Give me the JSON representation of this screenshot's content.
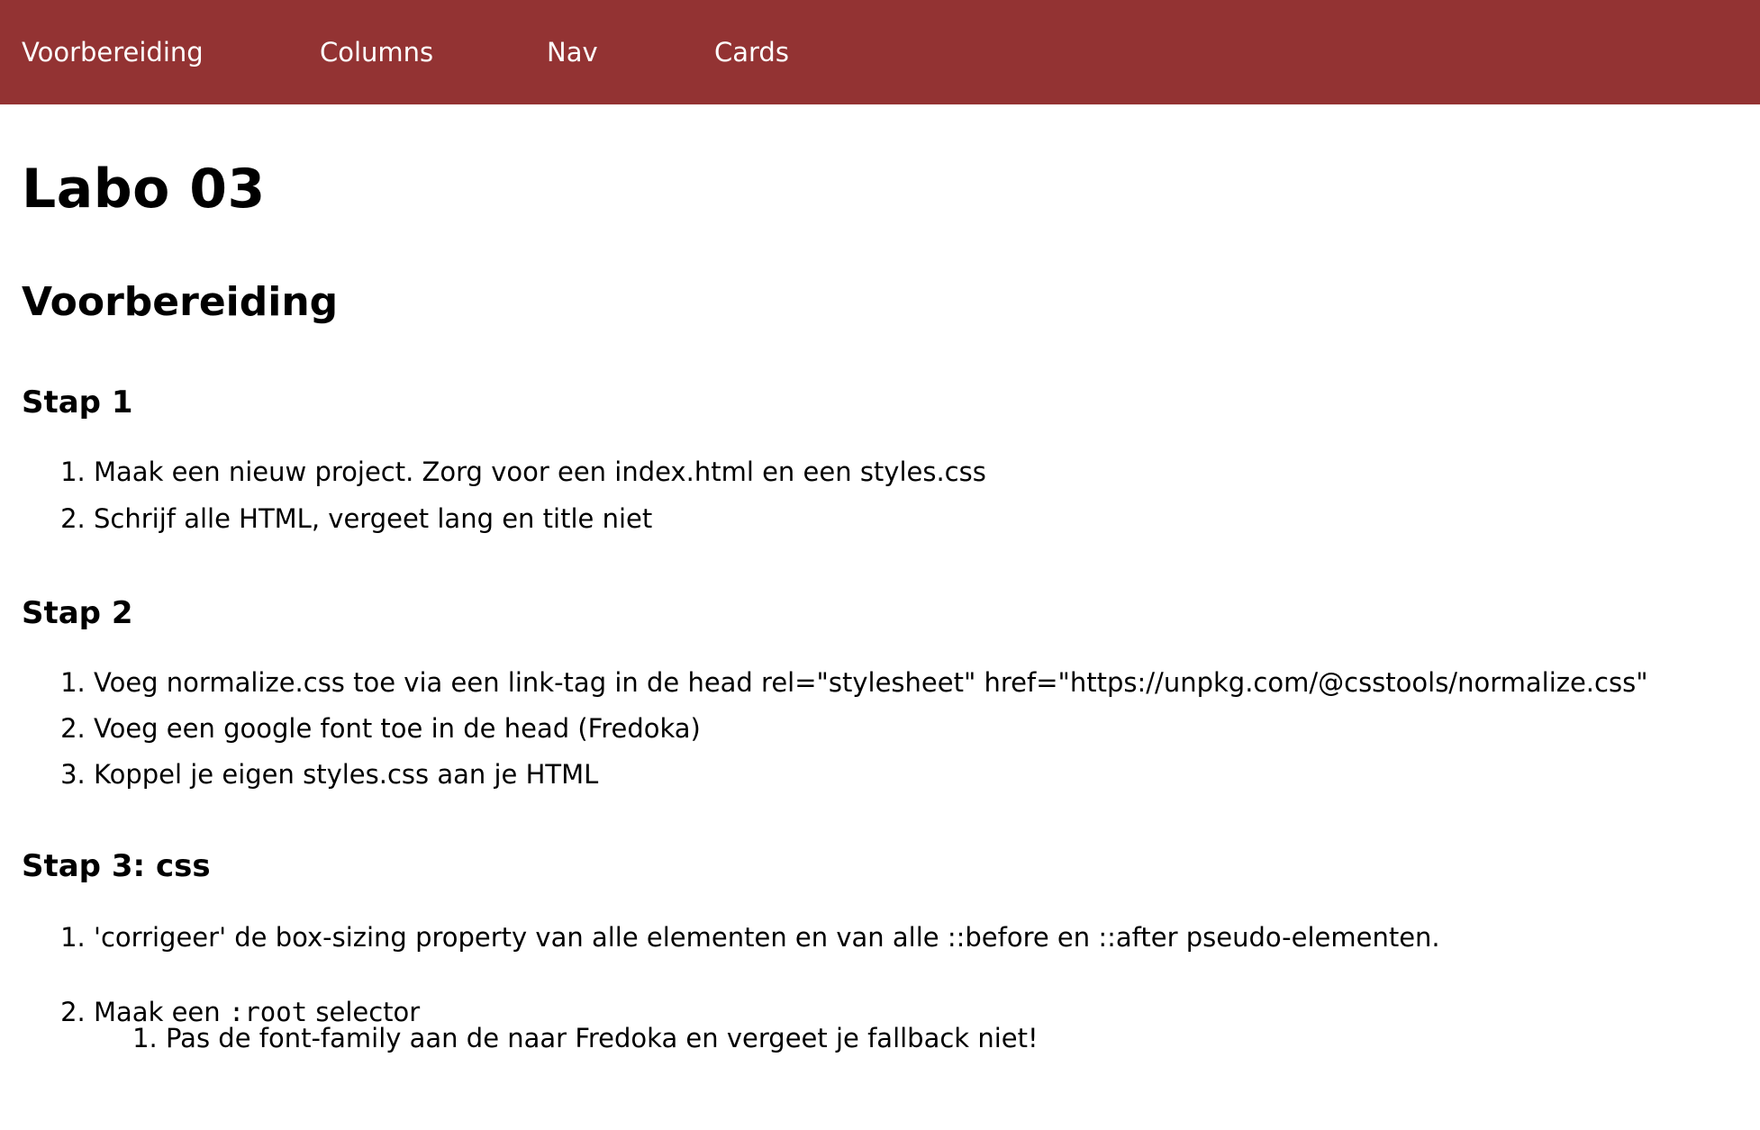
{
  "nav": {
    "background": "#933333",
    "items": [
      "Voorbereiding",
      "Columns",
      "Nav",
      "Cards"
    ]
  },
  "title": "Labo 03",
  "section": "Voorbereiding",
  "steps": [
    {
      "heading": "Stap 1",
      "items": [
        "Maak een nieuw project. Zorg voor een index.html en een styles.css",
        "Schrijf alle HTML, vergeet lang en title niet"
      ]
    },
    {
      "heading": "Stap 2",
      "items": [
        "Voeg normalize.css toe via een link-tag in de head rel=\"stylesheet\" href=\"https://unpkg.com/@csstools/normalize.css\"",
        "Voeg een google font toe in de head (Fredoka)",
        "Koppel je eigen styles.css aan je HTML"
      ]
    },
    {
      "heading": "Stap 3: css",
      "items": [
        "'corrigeer' de box-sizing property van alle elementen en van alle ::before en ::after pseudo-elementen.",
        {
          "before": "Maak een ",
          "code": ":root",
          "after": " selector"
        }
      ],
      "sub_items": [
        "Pas de font-family aan de naar Fredoka en vergeet je fallback niet!"
      ]
    }
  ]
}
